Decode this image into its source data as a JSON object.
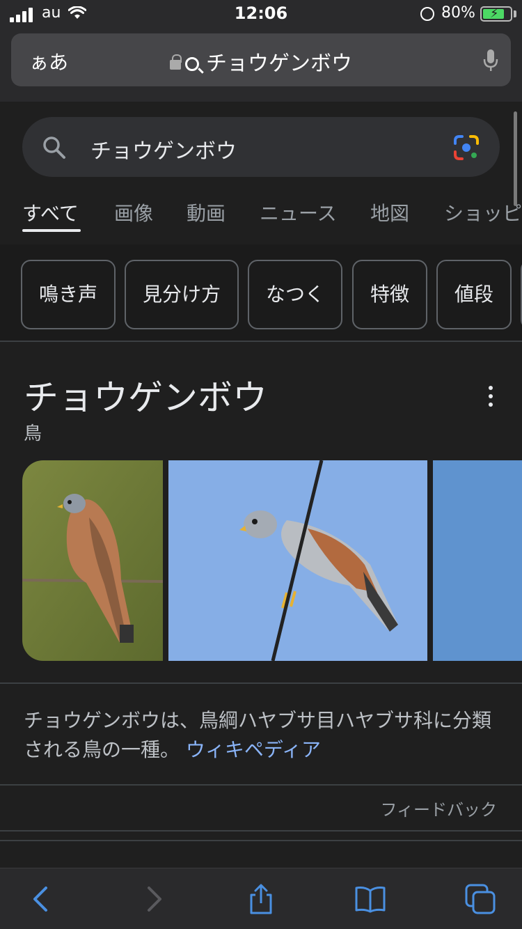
{
  "status_bar": {
    "carrier": "au",
    "time": "12:06",
    "battery_percent": "80%",
    "battery_level": 0.8,
    "charging": true
  },
  "address_bar": {
    "reader_label": "ぁあ",
    "query": "チョウゲンボウ",
    "icons": [
      "lock-icon",
      "search-icon",
      "microphone-icon"
    ]
  },
  "search": {
    "query": "チョウゲンボウ",
    "icons": [
      "search-icon",
      "google-lens-icon"
    ]
  },
  "tabs": [
    {
      "label": "すべて",
      "active": true
    },
    {
      "label": "画像",
      "active": false
    },
    {
      "label": "動画",
      "active": false
    },
    {
      "label": "ニュース",
      "active": false
    },
    {
      "label": "地図",
      "active": false
    },
    {
      "label": "ショッピ",
      "active": false
    }
  ],
  "chips": [
    "鳴き声",
    "見分け方",
    "なつく",
    "特徴",
    "値段"
  ],
  "knowledge_panel": {
    "title": "チョウゲンボウ",
    "subtitle": "鳥",
    "description": "チョウゲンボウは、鳥綱ハヤブサ目ハヤブサ科に分類される鳥の一種。",
    "source_link": "ウィキペディア",
    "feedback": "フィードバック",
    "images": [
      "kestrel-perched-on-wire-photo",
      "kestrel-on-cable-blue-sky-photo",
      "blue-sky-photo"
    ]
  },
  "toolbar": {
    "icons": [
      "back-icon",
      "forward-icon",
      "share-icon",
      "bookmarks-icon",
      "tabs-icon"
    ]
  },
  "colors": {
    "background": "#1f1f1f",
    "link": "#8ab4f8",
    "text": "#e8eaed",
    "secondary_text": "#9aa0a6",
    "accent_blue": "#4a90e2"
  }
}
